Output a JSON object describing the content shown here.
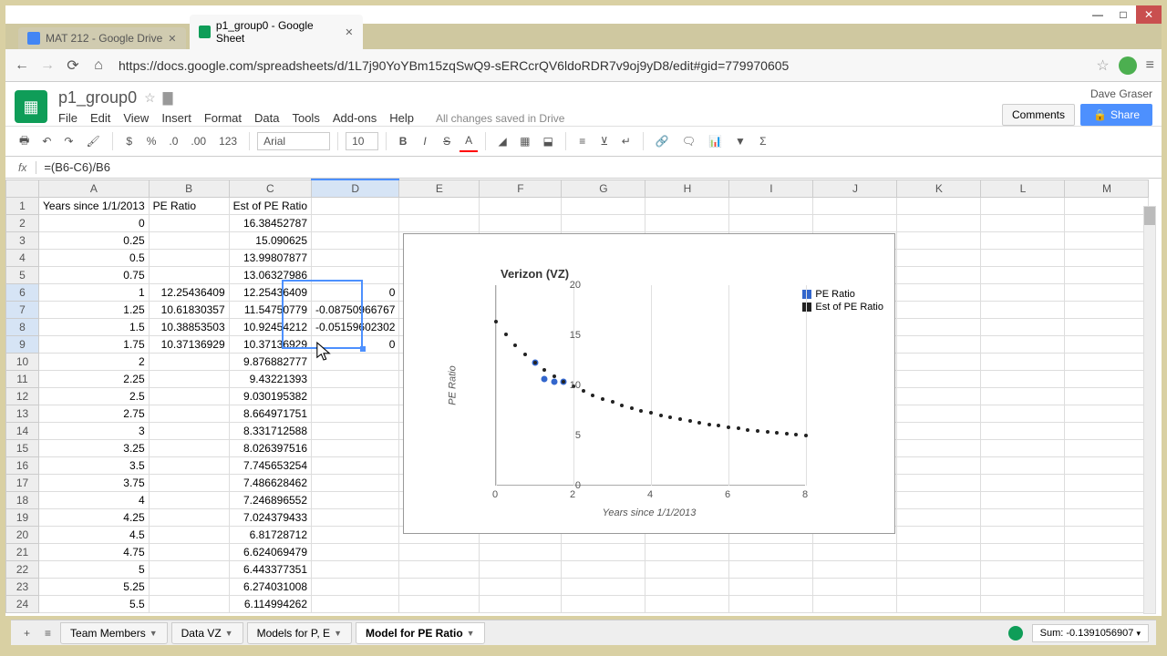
{
  "window": {
    "close": "✕",
    "min": "—",
    "max": "□"
  },
  "tabs": [
    {
      "title": "MAT 212 - Google Drive",
      "active": false
    },
    {
      "title": "p1_group0 - Google Sheet",
      "active": true
    }
  ],
  "url": "https://docs.google.com/spreadsheets/d/1L7j90YoYBm15zqSwQ9-sERCcrQV6ldoRDR7v9oj9yD8/edit#gid=779970605",
  "doc": {
    "title": "p1_group0",
    "user": "Dave Graser",
    "menu": [
      "File",
      "Edit",
      "View",
      "Insert",
      "Format",
      "Data",
      "Tools",
      "Add-ons",
      "Help"
    ],
    "saved": "All changes saved in Drive",
    "comments": "Comments",
    "share": "Share"
  },
  "toolbar": {
    "font": "Arial",
    "size": "10",
    "format123": "123"
  },
  "formula": {
    "fx": "fx",
    "value": "=(B6-C6)/B6"
  },
  "columns": [
    "A",
    "B",
    "C",
    "D",
    "E",
    "F",
    "G",
    "H",
    "I",
    "J",
    "K",
    "L",
    "M"
  ],
  "selected_col": "D",
  "selected_rows": [
    6,
    7,
    8,
    9
  ],
  "headers": {
    "A": "Years since 1/1/2013",
    "B": "PE Ratio",
    "C": "Est of PE Ratio"
  },
  "rows": [
    {
      "n": 1,
      "A": "Years since 1/1/2013",
      "B": "PE Ratio",
      "C": "Est of PE Ratio",
      "D": ""
    },
    {
      "n": 2,
      "A": "0",
      "B": "",
      "C": "16.38452787",
      "D": ""
    },
    {
      "n": 3,
      "A": "0.25",
      "B": "",
      "C": "15.090625",
      "D": ""
    },
    {
      "n": 4,
      "A": "0.5",
      "B": "",
      "C": "13.99807877",
      "D": ""
    },
    {
      "n": 5,
      "A": "0.75",
      "B": "",
      "C": "13.06327986",
      "D": ""
    },
    {
      "n": 6,
      "A": "1",
      "B": "12.25436409",
      "C": "12.25436409",
      "D": "0"
    },
    {
      "n": 7,
      "A": "1.25",
      "B": "10.61830357",
      "C": "11.54750779",
      "D": "-0.08750966767"
    },
    {
      "n": 8,
      "A": "1.5",
      "B": "10.38853503",
      "C": "10.92454212",
      "D": "-0.05159602302"
    },
    {
      "n": 9,
      "A": "1.75",
      "B": "10.37136929",
      "C": "10.37136929",
      "D": "0"
    },
    {
      "n": 10,
      "A": "2",
      "B": "",
      "C": "9.876882777",
      "D": ""
    },
    {
      "n": 11,
      "A": "2.25",
      "B": "",
      "C": "9.43221393",
      "D": ""
    },
    {
      "n": 12,
      "A": "2.5",
      "B": "",
      "C": "9.030195382",
      "D": ""
    },
    {
      "n": 13,
      "A": "2.75",
      "B": "",
      "C": "8.664971751",
      "D": ""
    },
    {
      "n": 14,
      "A": "3",
      "B": "",
      "C": "8.331712588",
      "D": ""
    },
    {
      "n": 15,
      "A": "3.25",
      "B": "",
      "C": "8.026397516",
      "D": ""
    },
    {
      "n": 16,
      "A": "3.5",
      "B": "",
      "C": "7.745653254",
      "D": ""
    },
    {
      "n": 17,
      "A": "3.75",
      "B": "",
      "C": "7.486628462",
      "D": ""
    },
    {
      "n": 18,
      "A": "4",
      "B": "",
      "C": "7.246896552",
      "D": ""
    },
    {
      "n": 19,
      "A": "4.25",
      "B": "",
      "C": "7.024379433",
      "D": ""
    },
    {
      "n": 20,
      "A": "4.5",
      "B": "",
      "C": "6.81728712",
      "D": ""
    },
    {
      "n": 21,
      "A": "4.75",
      "B": "",
      "C": "6.624069479",
      "D": ""
    },
    {
      "n": 22,
      "A": "5",
      "B": "",
      "C": "6.443377351",
      "D": ""
    },
    {
      "n": 23,
      "A": "5.25",
      "B": "",
      "C": "6.274031008",
      "D": ""
    },
    {
      "n": 24,
      "A": "5.5",
      "B": "",
      "C": "6.114994262",
      "D": ""
    }
  ],
  "chart_data": {
    "type": "scatter",
    "title": "Verizon (VZ)",
    "xlabel": "Years since 1/1/2013",
    "ylabel": "PE Ratio",
    "xlim": [
      0,
      8
    ],
    "ylim": [
      0,
      20
    ],
    "x_ticks": [
      0,
      2,
      4,
      6,
      8
    ],
    "y_ticks": [
      0,
      5,
      10,
      15,
      20
    ],
    "series": [
      {
        "name": "PE Ratio",
        "color": "#3366cc",
        "x": [
          1,
          1.25,
          1.5,
          1.75
        ],
        "y": [
          12.25,
          10.62,
          10.39,
          10.37
        ]
      },
      {
        "name": "Est of PE Ratio",
        "color": "#222222",
        "x": [
          0,
          0.25,
          0.5,
          0.75,
          1,
          1.25,
          1.5,
          1.75,
          2,
          2.25,
          2.5,
          2.75,
          3,
          3.25,
          3.5,
          3.75,
          4,
          4.25,
          4.5,
          4.75,
          5,
          5.25,
          5.5,
          5.75,
          6,
          6.25,
          6.5,
          6.75,
          7,
          7.25,
          7.5,
          7.75,
          8
        ],
        "y": [
          16.38,
          15.09,
          14.0,
          13.06,
          12.25,
          11.55,
          10.92,
          10.37,
          9.88,
          9.43,
          9.03,
          8.66,
          8.33,
          8.03,
          7.75,
          7.49,
          7.25,
          7.02,
          6.82,
          6.62,
          6.44,
          6.27,
          6.11,
          5.97,
          5.83,
          5.7,
          5.58,
          5.47,
          5.36,
          5.26,
          5.16,
          5.07,
          4.99
        ]
      }
    ]
  },
  "sheet_tabs": [
    {
      "label": "Team Members",
      "active": false
    },
    {
      "label": "Data VZ",
      "active": false
    },
    {
      "label": "Models for P, E",
      "active": false
    },
    {
      "label": "Model for PE Ratio",
      "active": true
    }
  ],
  "status": {
    "sum": "Sum: -0.1391056907"
  }
}
